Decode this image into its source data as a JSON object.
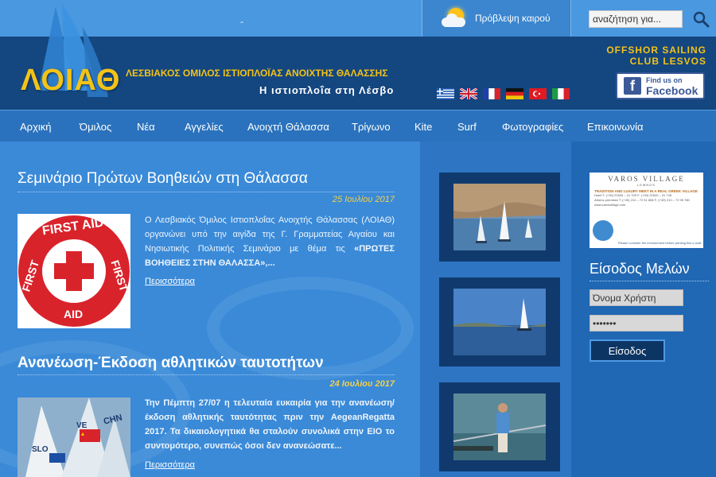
{
  "top": {
    "dash": "-",
    "weather_label": "Πρόβλεψη καιρού",
    "search_placeholder": "αναζήτηση για..."
  },
  "header": {
    "logo_text": "ΛΟΙΑΘ",
    "club_title": "ΛΕΣΒΙΑΚΟΣ ΟΜΙΛΟΣ ΙΣΤΙΟΠΛΟΪΑΣ ΑΝΟΙΧΤΗΣ ΘΑΛΑΣΣΗΣ",
    "club_subtitle": "Η ιστιοπλοΐα στη Λέσβο",
    "offshore_line1": "OFFSHOR SAILING",
    "offshore_line2": "CLUB LESVOS",
    "facebook_small": "Find us on",
    "facebook_big": "Facebook",
    "flags": [
      "greek-flag",
      "uk-flag",
      "french-flag",
      "german-flag",
      "turkish-flag",
      "italian-flag"
    ]
  },
  "nav": {
    "items": [
      "Αρχική",
      "Όμιλος",
      "Νέα",
      "Αγγελίες",
      "Ανοιχτή Θάλασσα",
      "Τρίγωνο",
      "Kite",
      "Surf",
      "Φωτογραφίες",
      "Επικοινωνία"
    ]
  },
  "articles": [
    {
      "title": "Σεμινάριο Πρώτων Βοηθειών στη Θάλασσα",
      "date": "25 Ιουλίου 2017",
      "text": "Ο Λεσβιακός Όμιλος Ιστιοπλοΐας Ανοιχτής Θάλασσας (ΛΟΙΑΘ) οργανώνει υπό την αιγίδα της Γ. Γραμματείας Αιγαίου και Νησιωτικής Πολιτικής Σεμινάριο με θέμα τις ",
      "text_bold": "«ΠΡΩΤΕΣ ΒΟΗΘΕΙΕΣ ΣΤΗΝ ΘΑΛΑΣΣΑ»,...",
      "thumb_text_top": "FIRST AID",
      "thumb_text_left": "FIRST",
      "thumb_text_right": "FIRST",
      "thumb_text_bottom": "AID",
      "more": "Περισσότερα"
    },
    {
      "title": "Ανανέωση-Έκδοση αθλητικών ταυτοτήτων",
      "date": "24 Ιουλίου 2017",
      "text": "Την Πέμπτη 27/07 η τελευταία ευκαιρία για την ανανέωση/ έκδοση αθλητικής ταυτότητας πριν την AegeanRegatta 2017. Τα δικαιολογητικά θα σταλούν συνολικά στην ΕΙΟ το συντομότερο, συνεπώς όσοι δεν ανανεώσατε...",
      "thumb_sail_labels": [
        "CHN",
        "VE",
        "SLO"
      ],
      "more": "Περισσότερα"
    }
  ],
  "ad": {
    "title": "VAROS VILLAGE",
    "subtitle": "LEMNOS",
    "tagline": "TRADITION AND LUXURY MEET IN A REAL GREEK VILLAGE",
    "lines": [
      "Hotel            T: (+30) 22540 – 31 709  F: (+30) 22540 – 31 728",
      "Athens premises  T: (+30) 210 – 72 51 808  F: (+30) 210 – 72 95 780",
      "www.varosvillage.com"
    ],
    "footer": "Please consider the environment before printing this e-mail"
  },
  "login": {
    "title": "Είσοδος Μελών",
    "username_placeholder": "Όνομα Χρήστη",
    "password_value": "•••••••",
    "button": "Είσοδος"
  },
  "colors": {
    "accent_yellow": "#f3c317",
    "header_navy": "#14467f",
    "nav_blue": "#2a72bd",
    "body_blue": "#3a88d6"
  }
}
